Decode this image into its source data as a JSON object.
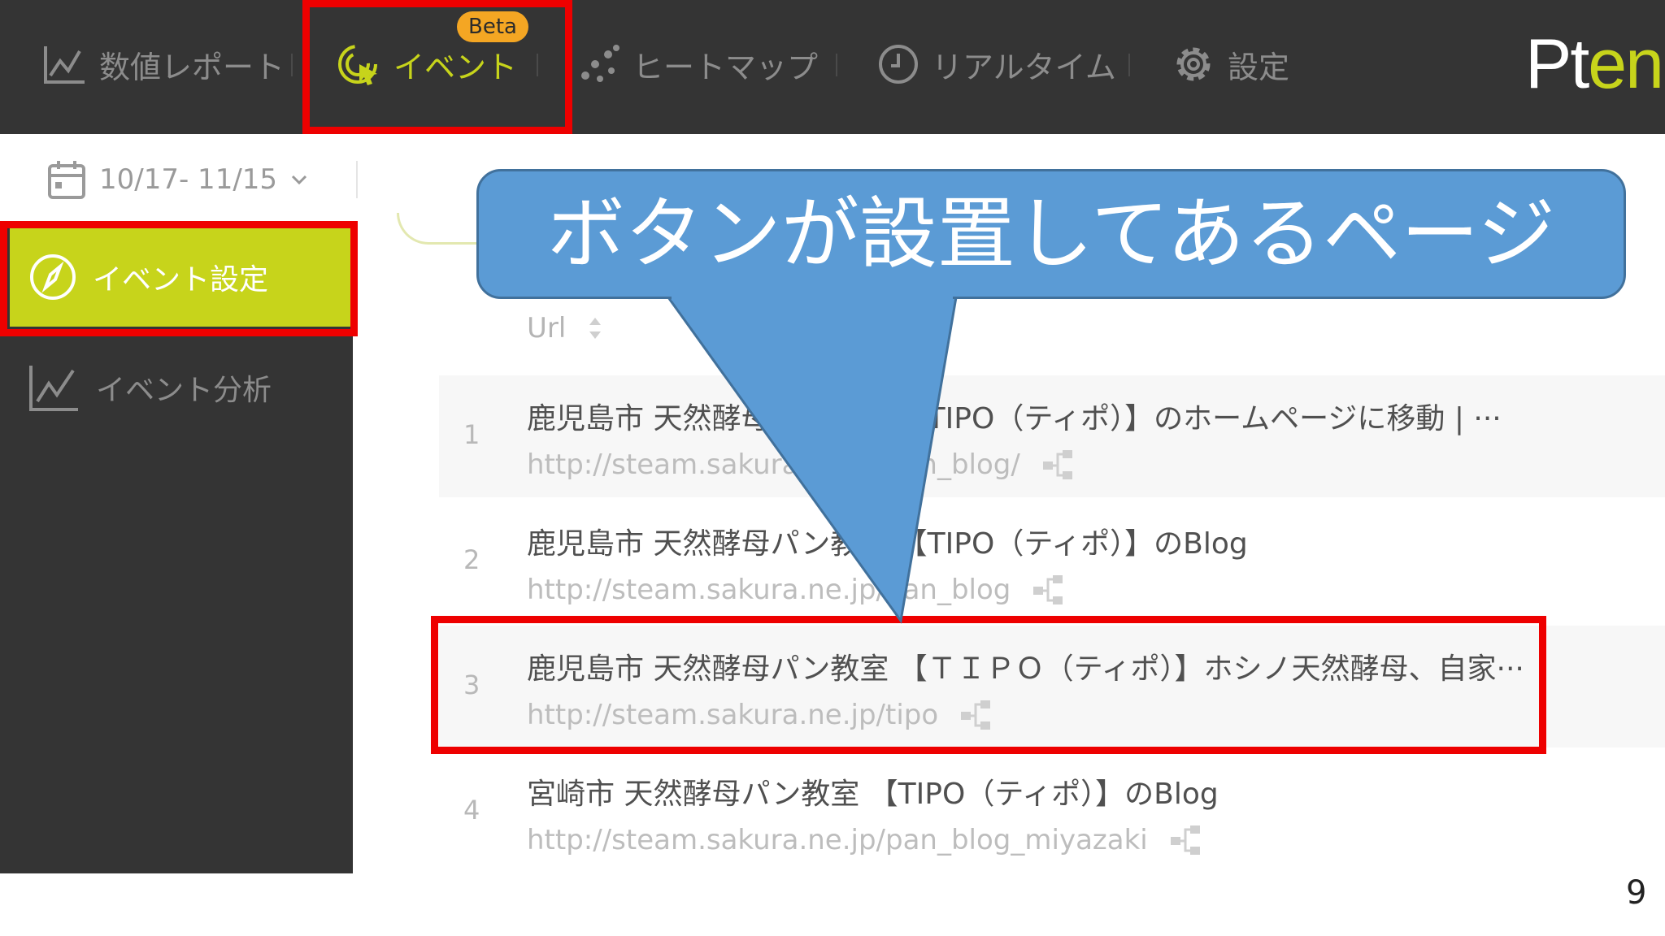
{
  "brand": {
    "part1": "Pt",
    "part2": "engine"
  },
  "nav": {
    "items": [
      {
        "label": "数値レポート",
        "icon": "line-chart-icon"
      },
      {
        "label": "イベント",
        "icon": "target-click-icon",
        "badge": "Beta"
      },
      {
        "label": "ヒートマップ",
        "icon": "dots-scatter-icon"
      },
      {
        "label": "リアルタイム",
        "icon": "clock-icon"
      },
      {
        "label": "設定",
        "icon": "gear-icon"
      }
    ]
  },
  "date_range": {
    "label": "10/17- 11/15",
    "icon": "calendar-icon"
  },
  "sidebar": {
    "items": [
      {
        "label": "イベント設定",
        "icon": "compass-icon",
        "active": true
      },
      {
        "label": "イベント分析",
        "icon": "line-chart-icon",
        "active": false
      }
    ]
  },
  "table": {
    "column_header": "Url",
    "rows": [
      {
        "num": "1",
        "title": "鹿児島市 天然酵母パン教室 【TIPO（ティポ）】のホームページに移動 | ···",
        "url": "http://steam.sakura.ne.jp/pan_blog/"
      },
      {
        "num": "2",
        "title": "鹿児島市 天然酵母パン教室 【TIPO（ティポ）】のBlog",
        "url": "http://steam.sakura.ne.jp/pan_blog"
      },
      {
        "num": "3",
        "title": "鹿児島市 天然酵母パン教室 【ＴＩＰＯ（ティポ）】ホシノ天然酵母、自家···",
        "url": "http://steam.sakura.ne.jp/tipo"
      },
      {
        "num": "4",
        "title": "宮崎市 天然酵母パン教室 【TIPO（ティポ）】のBlog",
        "url": "http://steam.sakura.ne.jp/pan_blog_miyazaki"
      }
    ]
  },
  "callout": {
    "text": "ボタンが設置してあるページ"
  },
  "page_number": "9",
  "colors": {
    "accent": "#c7d41b",
    "highlight": "#ee0000",
    "callout": "#5b9bd5",
    "nav_bg": "#343434"
  }
}
